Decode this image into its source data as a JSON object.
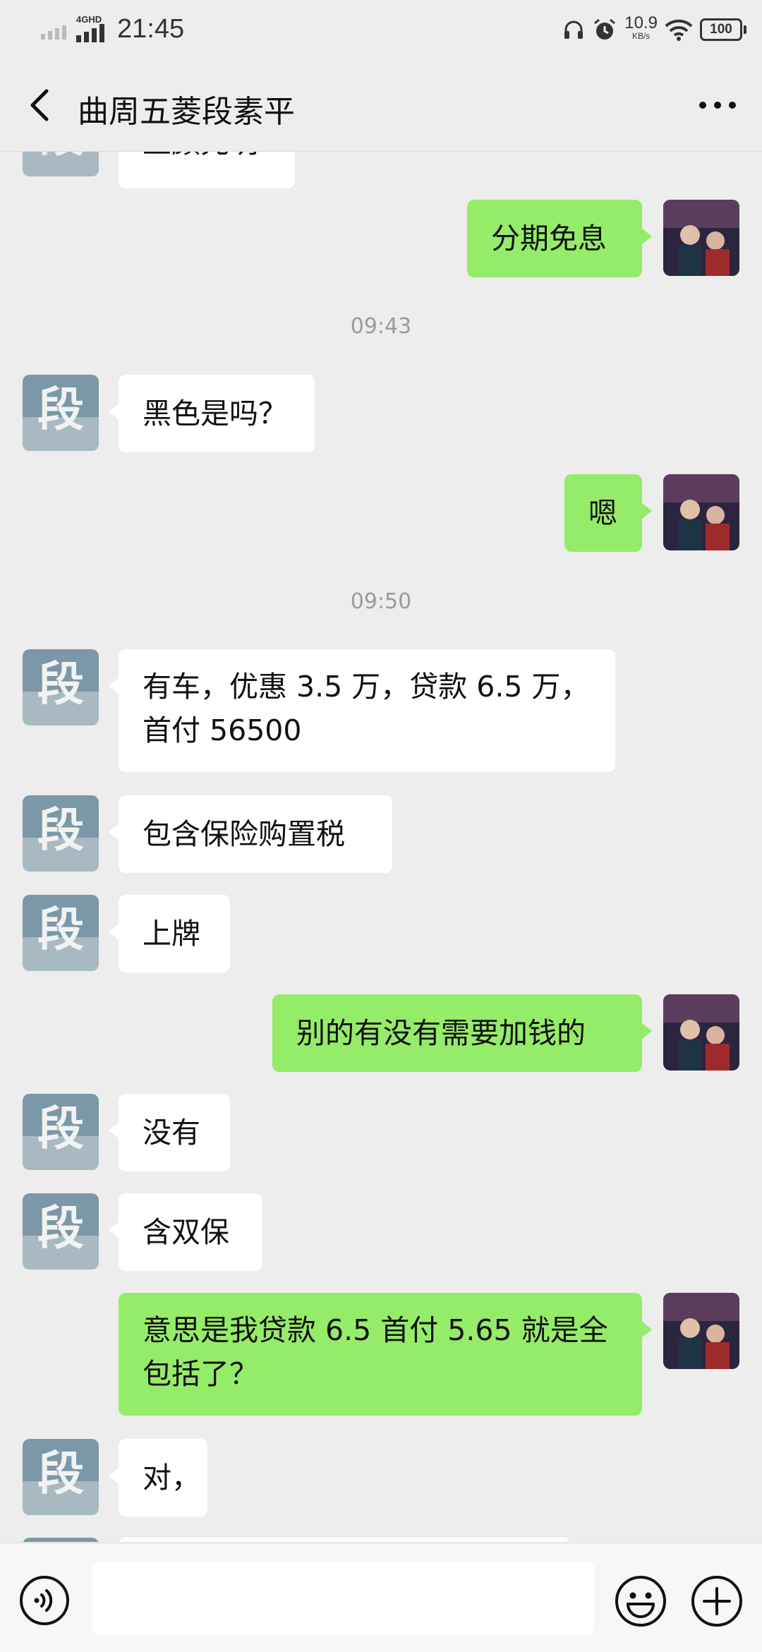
{
  "status_bar": {
    "network_type": "4GHD",
    "time": "21:45",
    "net_speed_value": "10.9",
    "net_speed_unit": "KB/s",
    "battery": "100"
  },
  "header": {
    "title": "曲周五菱段素平"
  },
  "messages": [
    {
      "sender": "contact",
      "text": "上颜先明",
      "partial": true
    },
    {
      "sender": "me",
      "text": "分期免息"
    },
    {
      "type": "timestamp",
      "text": "09:43"
    },
    {
      "sender": "contact",
      "text": "黑色是吗？"
    },
    {
      "sender": "me",
      "text": "嗯"
    },
    {
      "type": "timestamp",
      "text": "09:50"
    },
    {
      "sender": "contact",
      "text": "有车，优惠 3.5 万，贷款 6.5 万，首付 56500"
    },
    {
      "sender": "contact",
      "text": "包含保险购置税"
    },
    {
      "sender": "contact",
      "text": "上牌"
    },
    {
      "sender": "me",
      "text": "别的有没有需要加钱的"
    },
    {
      "sender": "contact",
      "text": "没有"
    },
    {
      "sender": "contact",
      "text": "含双保"
    },
    {
      "sender": "me",
      "text": "意思是我贷款 6.5  首付 5.65  就是全包括了？"
    },
    {
      "sender": "contact",
      "text": "对，"
    }
  ],
  "input": {
    "value": "",
    "placeholder": ""
  },
  "colors": {
    "background": "#ededed",
    "my_bubble": "#95ec69",
    "their_bubble": "#ffffff",
    "timestamp": "#9a9a9a"
  },
  "icons": {
    "back": "chevron-left-icon",
    "more": "more-dots-icon",
    "voice": "voice-icon",
    "emoji": "emoji-icon",
    "plus": "plus-icon"
  }
}
